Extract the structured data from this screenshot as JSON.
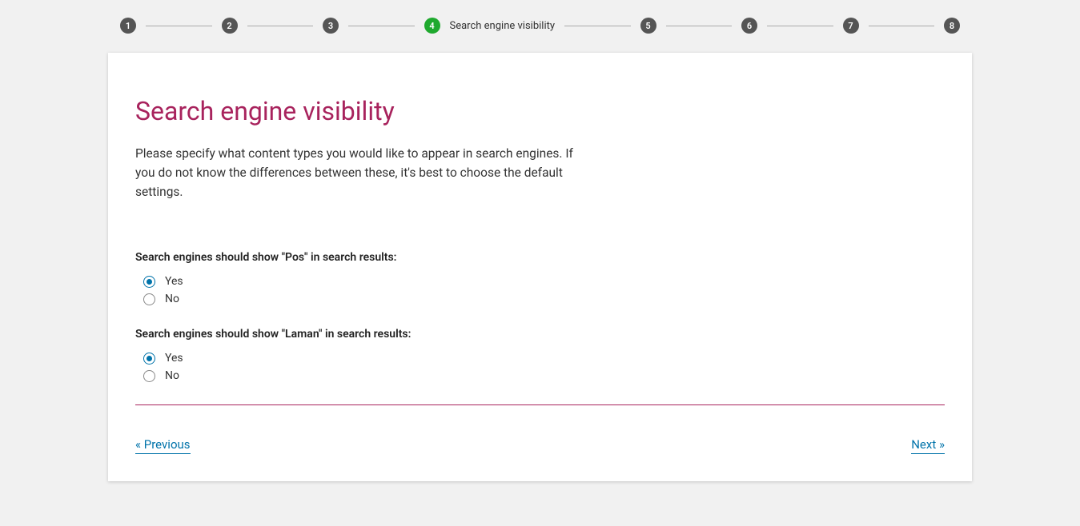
{
  "stepper": {
    "steps": [
      {
        "num": "1",
        "active": false,
        "label": ""
      },
      {
        "num": "2",
        "active": false,
        "label": ""
      },
      {
        "num": "3",
        "active": false,
        "label": ""
      },
      {
        "num": "4",
        "active": true,
        "label": "Search engine visibility"
      },
      {
        "num": "5",
        "active": false,
        "label": ""
      },
      {
        "num": "6",
        "active": false,
        "label": ""
      },
      {
        "num": "7",
        "active": false,
        "label": ""
      },
      {
        "num": "8",
        "active": false,
        "label": ""
      }
    ]
  },
  "page": {
    "title": "Search engine visibility",
    "intro": "Please specify what content types you would like to appear in search engines. If you do not know the differences between these, it's best to choose the default settings."
  },
  "questions": [
    {
      "text": "Search engines should show \"Pos\" in search results:",
      "options": [
        {
          "label": "Yes",
          "checked": true
        },
        {
          "label": "No",
          "checked": false
        }
      ]
    },
    {
      "text": "Search engines should show \"Laman\" in search results:",
      "options": [
        {
          "label": "Yes",
          "checked": true
        },
        {
          "label": "No",
          "checked": false
        }
      ]
    }
  ],
  "nav": {
    "previous": "« Previous",
    "next": "Next »"
  }
}
